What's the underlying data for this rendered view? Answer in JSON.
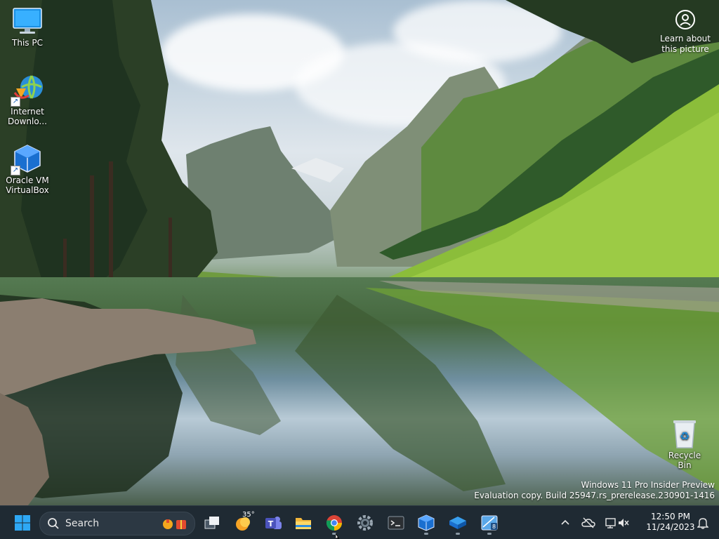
{
  "desktop": {
    "icons": [
      {
        "label": "This PC"
      },
      {
        "label": "Internet Downlo..."
      },
      {
        "label": "Oracle VM VirtualBox"
      },
      {
        "label": "Recycle Bin"
      }
    ],
    "learn_label": "Learn about this picture",
    "watermark_line1": "Windows 11 Pro Insider Preview",
    "watermark_line2": "Evaluation copy. Build 25947.rs_prerelease.230901-1416"
  },
  "taskbar": {
    "search_placeholder": "Search",
    "weather_temp": "35°",
    "apps": [
      {
        "icon": "task-view-icon"
      },
      {
        "icon": "weather-icon"
      },
      {
        "icon": "teams-icon"
      },
      {
        "icon": "file-explorer-icon"
      },
      {
        "icon": "chrome-icon"
      },
      {
        "icon": "settings-icon"
      },
      {
        "icon": "terminal-icon"
      },
      {
        "icon": "virtualbox-icon"
      },
      {
        "icon": "virtualbox-manager-icon"
      },
      {
        "icon": "installer-icon"
      }
    ],
    "clock_time": "12:50 PM",
    "clock_date": "11/24/2023"
  },
  "colors": {
    "taskbar_bg": "#1f2a33",
    "accent": "#1a8fe3"
  }
}
